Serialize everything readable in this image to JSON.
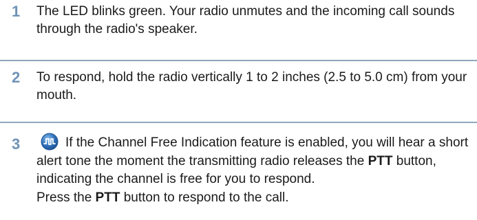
{
  "steps": [
    {
      "number": "1",
      "text": "The LED blinks green. Your radio unmutes and the incoming call sounds through the radio's speaker."
    },
    {
      "number": "2",
      "text": "To respond, hold the radio vertically 1 to 2 inches (2.5 to 5.0 cm) from your mouth."
    },
    {
      "number": "3",
      "icon": "channel-free-indication-icon",
      "line1": "If the Channel Free Indication feature is enabled, you will hear a short alert tone the moment the transmitting radio releases the ",
      "bold1": "PTT",
      "line1_end": " button, indicating the channel is free for you to respond.",
      "line2_start": "Press the ",
      "bold2": "PTT",
      "line2_end": " button to respond to the call."
    }
  ],
  "colors": {
    "step_number": "#6f93b6",
    "divider": "#8fa6bd",
    "icon_blue": "#2f6fb8"
  }
}
